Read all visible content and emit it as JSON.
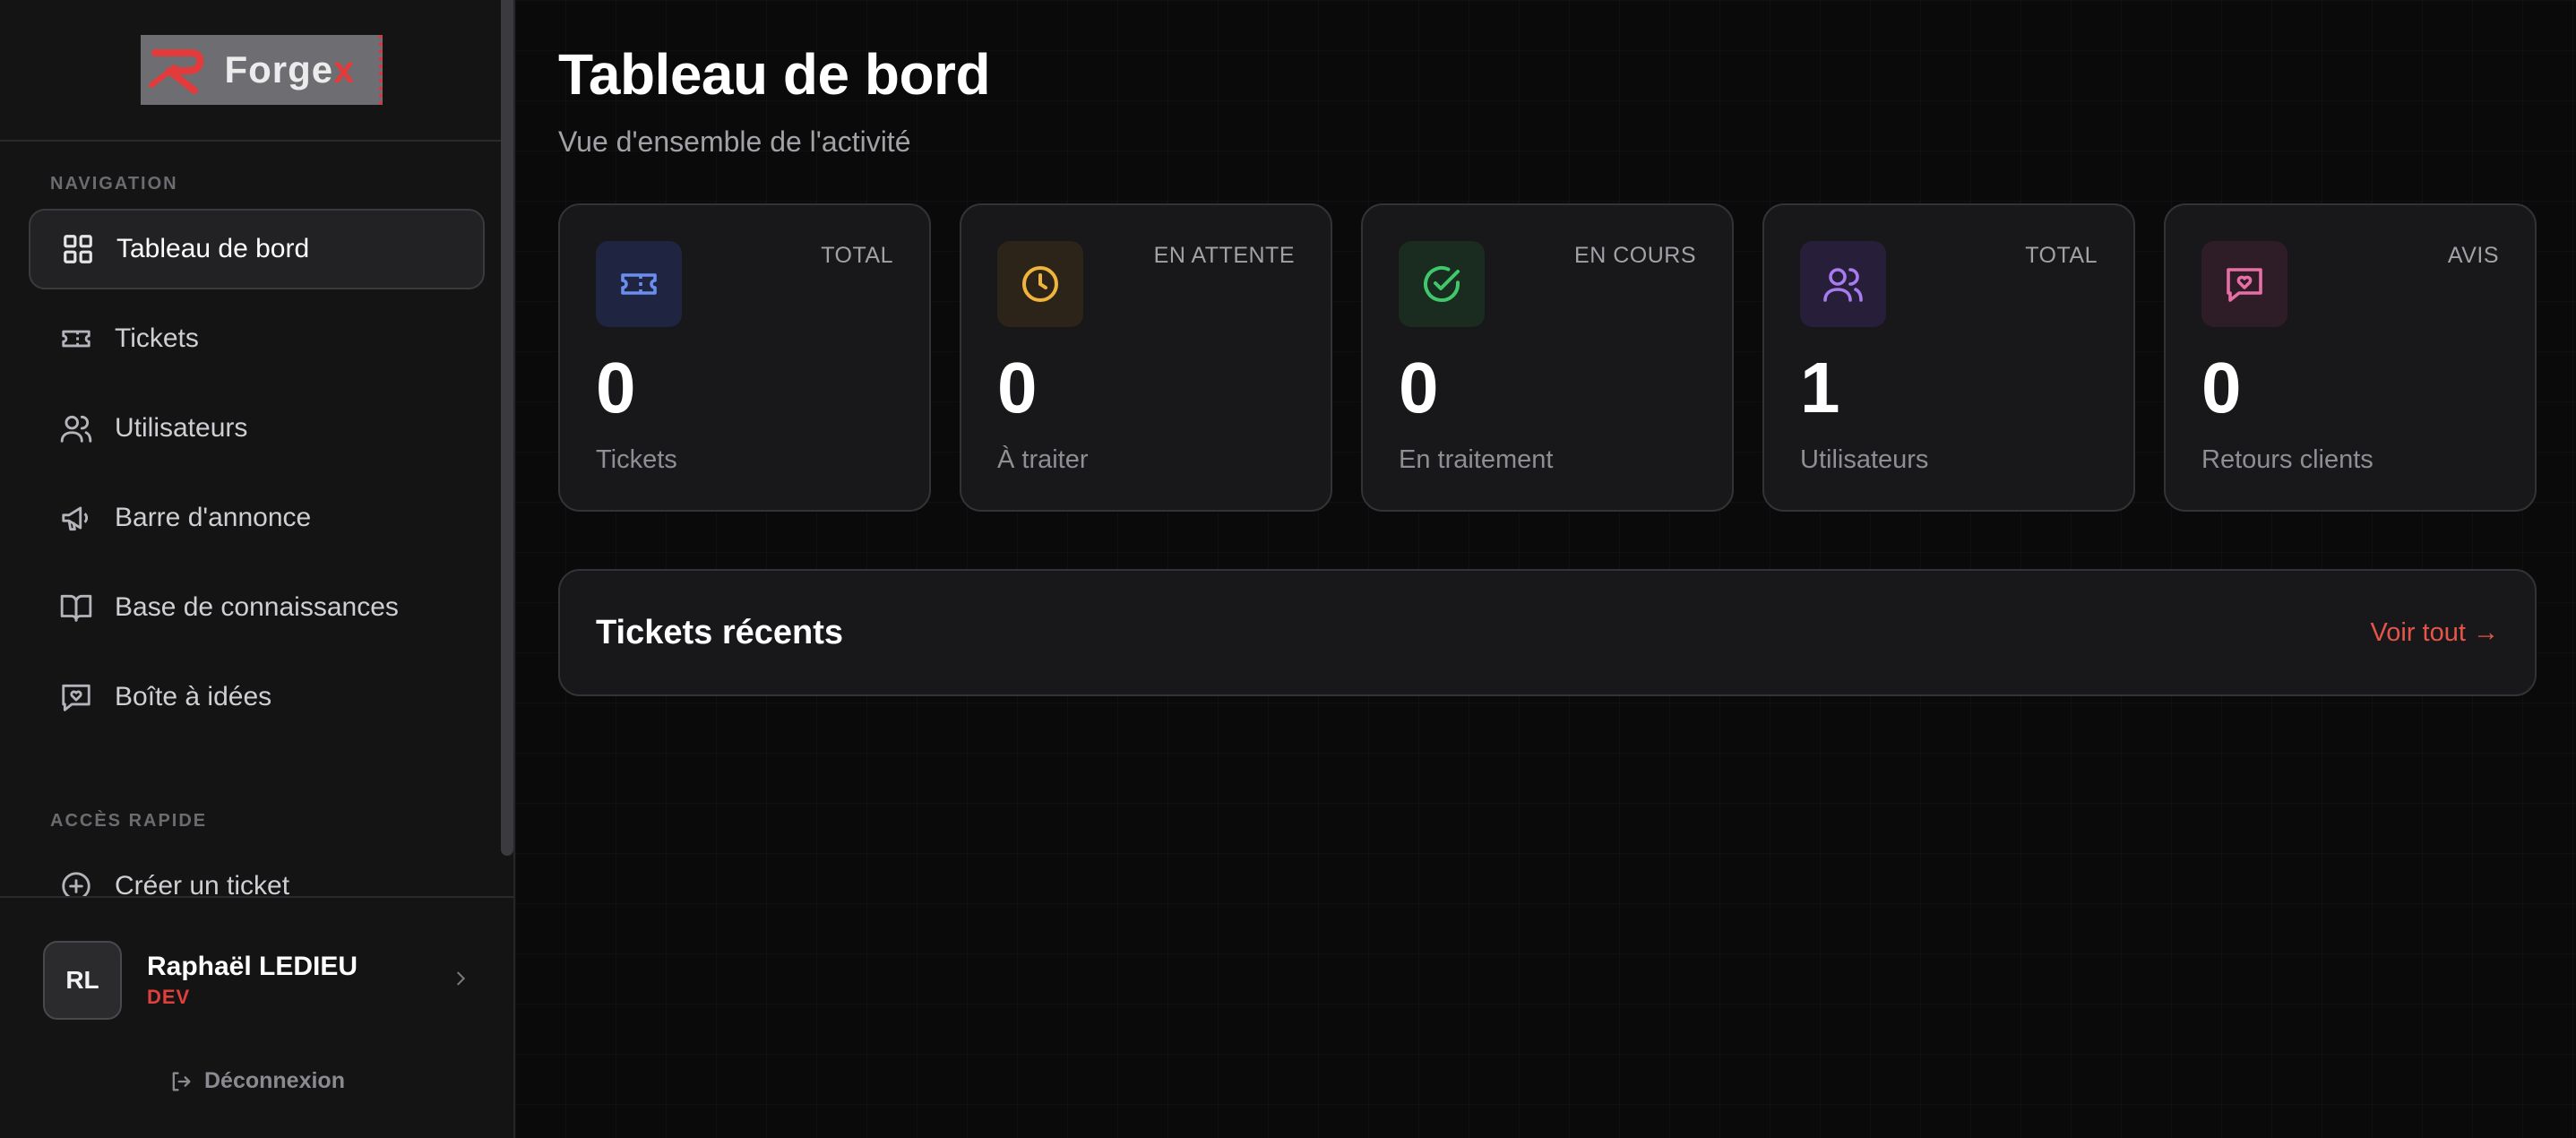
{
  "brand": {
    "name_prefix": "Forge",
    "name_suffix": "x",
    "accent": "#e33b3b"
  },
  "sidebar": {
    "nav_section_label": "NAVIGATION",
    "items": [
      {
        "label": "Tableau de bord",
        "icon": "dashboard-grid-icon",
        "active": true
      },
      {
        "label": "Tickets",
        "icon": "ticket-icon"
      },
      {
        "label": "Utilisateurs",
        "icon": "users-icon"
      },
      {
        "label": "Barre d'annonce",
        "icon": "megaphone-icon"
      },
      {
        "label": "Base de connaissances",
        "icon": "book-open-icon"
      },
      {
        "label": "Boîte à idées",
        "icon": "message-heart-icon"
      }
    ],
    "quick_section_label": "ACCÈS RAPIDE",
    "quick_items": [
      {
        "label": "Créer un ticket",
        "icon": "plus-circle-icon"
      }
    ],
    "user": {
      "initials": "RL",
      "name": "Raphaël LEDIEU",
      "role": "DEV"
    },
    "logout_label": "Déconnexion"
  },
  "main": {
    "title": "Tableau de bord",
    "subtitle": "Vue d'ensemble de l'activité",
    "stats": [
      {
        "tag": "TOTAL",
        "value": "0",
        "label": "Tickets",
        "icon": "ticket-icon",
        "color": "#6b8cf0"
      },
      {
        "tag": "EN ATTENTE",
        "value": "0",
        "label": "À traiter",
        "icon": "clock-icon",
        "color": "#f0b43a"
      },
      {
        "tag": "EN COURS",
        "value": "0",
        "label": "En traitement",
        "icon": "check-circle-icon",
        "color": "#3fc86b"
      },
      {
        "tag": "TOTAL",
        "value": "1",
        "label": "Utilisateurs",
        "icon": "users-icon",
        "color": "#a87cf0"
      },
      {
        "tag": "AVIS",
        "value": "0",
        "label": "Retours clients",
        "icon": "message-heart-icon",
        "color": "#e86fa6"
      }
    ],
    "recent": {
      "title": "Tickets récents",
      "link_label": "Voir tout →"
    }
  }
}
